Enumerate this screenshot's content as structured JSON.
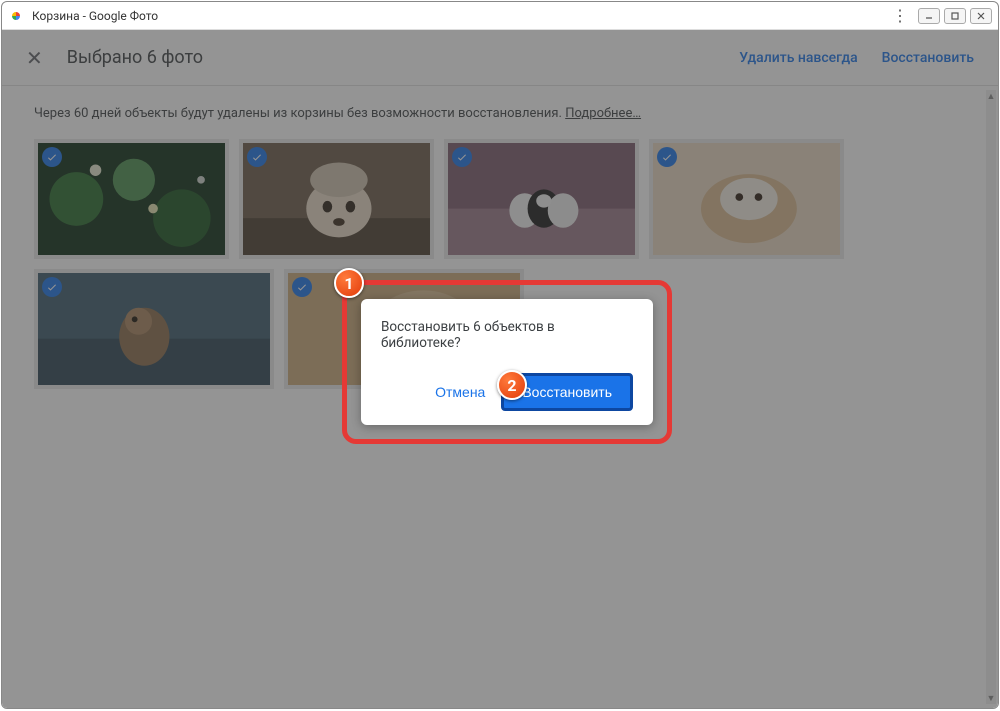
{
  "window": {
    "title": "Корзина - Google Фото"
  },
  "selection_bar": {
    "title": "Выбрано 6 фото",
    "delete_forever": "Удалить навсегда",
    "restore": "Восстановить"
  },
  "notice": {
    "text": "Через 60 дней объекты будут удалены из корзины без возможности восстановления. ",
    "more": "Подробнее…"
  },
  "dialog": {
    "message": "Восстановить 6 объектов в библиотеке?",
    "cancel": "Отмена",
    "confirm": "Восстановить"
  },
  "badges": {
    "one": "1",
    "two": "2"
  },
  "thumbs": [
    {
      "name": "green-bokeh"
    },
    {
      "name": "dog-hat"
    },
    {
      "name": "puppies-group"
    },
    {
      "name": "guinea-pig"
    },
    {
      "name": "monkey"
    },
    {
      "name": "dog-closeup"
    }
  ]
}
